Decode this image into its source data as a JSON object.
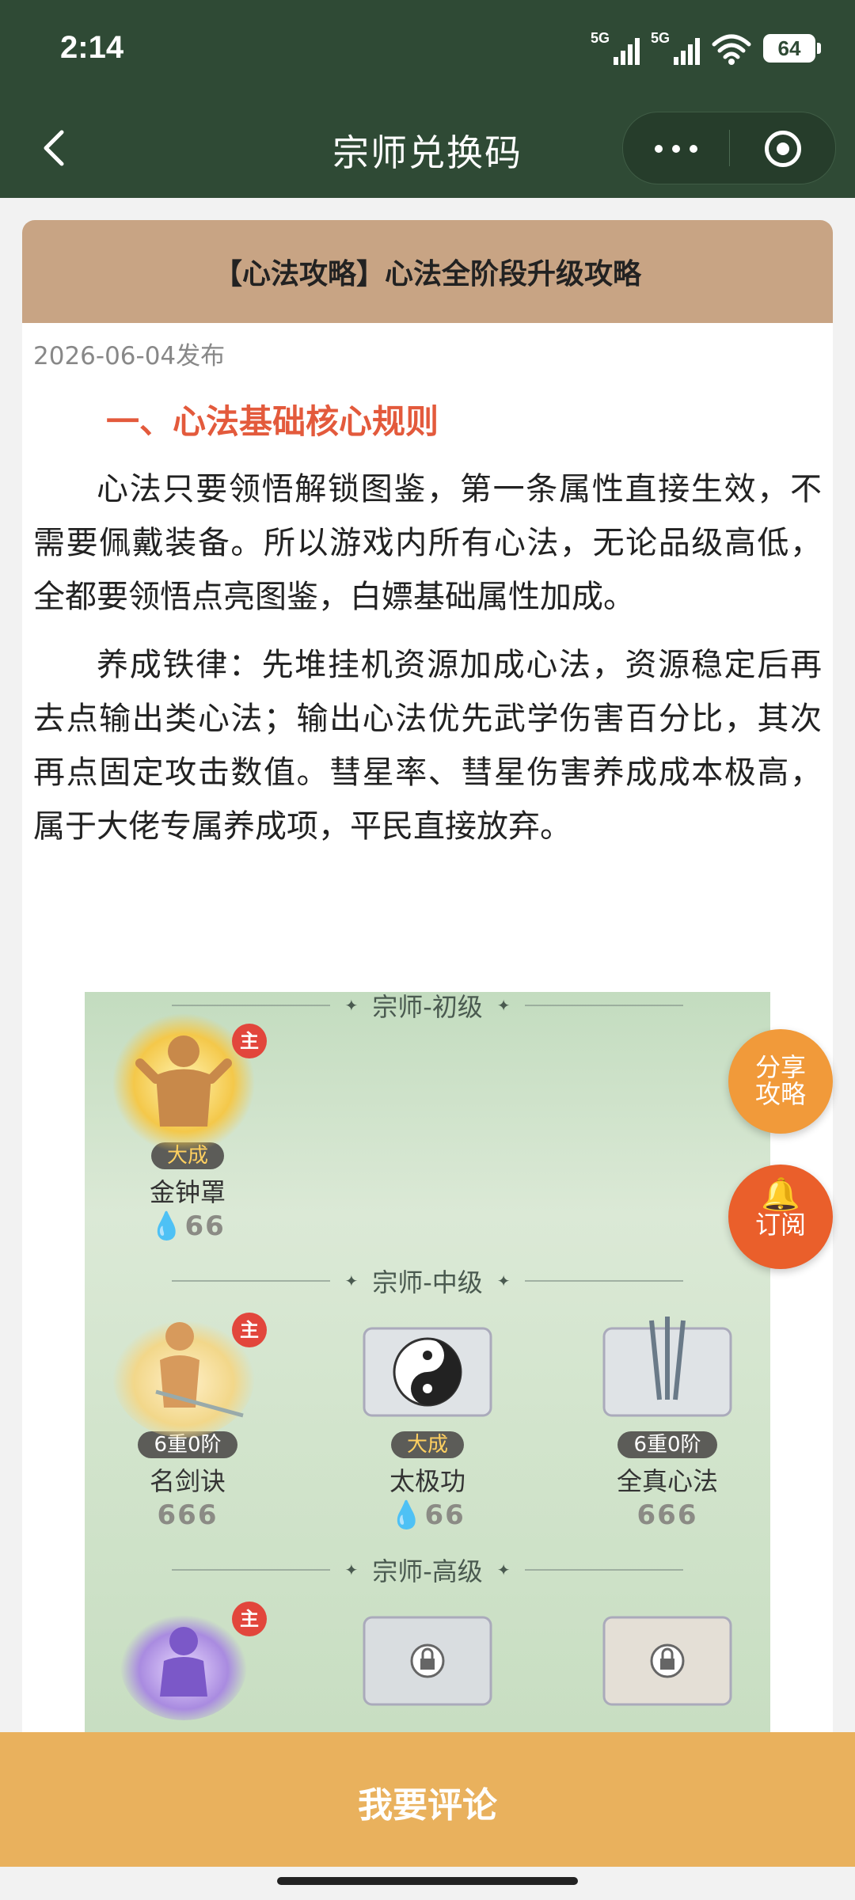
{
  "status": {
    "time": "2:14",
    "network1": "5G",
    "network2": "5G",
    "battery": "64"
  },
  "nav": {
    "title": "宗师兑换码"
  },
  "article": {
    "title": "【心法攻略】心法全阶段升级攻略",
    "published": "2026-06-04发布",
    "section1_heading": "一、心法基础核心规则",
    "paragraph1": "心法只要领悟解锁图鉴，第一条属性直接生效，不需要佩戴装备。所以游戏内所有心法，无论品级高低，全都要领悟点亮图鉴，白嫖基础属性加成。",
    "paragraph2": "养成铁律：先堆挂机资源加成心法，资源稳定后再去点输出类心法；输出心法优先武学伤害百分比，其次再点固定攻击数值。彗星率、彗星伤害养成成本极高，属于大佬专属养成项，平民直接放弃。"
  },
  "image": {
    "tier1": "宗师-初级",
    "tier2": "宗师-中级",
    "tier3": "宗师-高级",
    "master_tag": "主",
    "skills": [
      {
        "name": "金钟罩",
        "badge": "大成",
        "pip": "6"
      },
      {
        "name": "名剑诀",
        "badge": "6重0阶",
        "pip": "6"
      },
      {
        "name": "太极功",
        "badge": "大成",
        "pip": "6"
      },
      {
        "name": "全真心法",
        "badge": "6重0阶",
        "pip": "6"
      }
    ]
  },
  "fab": {
    "share": "分享攻略",
    "subscribe": "订阅",
    "bell_icon": "🔔"
  },
  "comment": {
    "label": "我要评论"
  }
}
